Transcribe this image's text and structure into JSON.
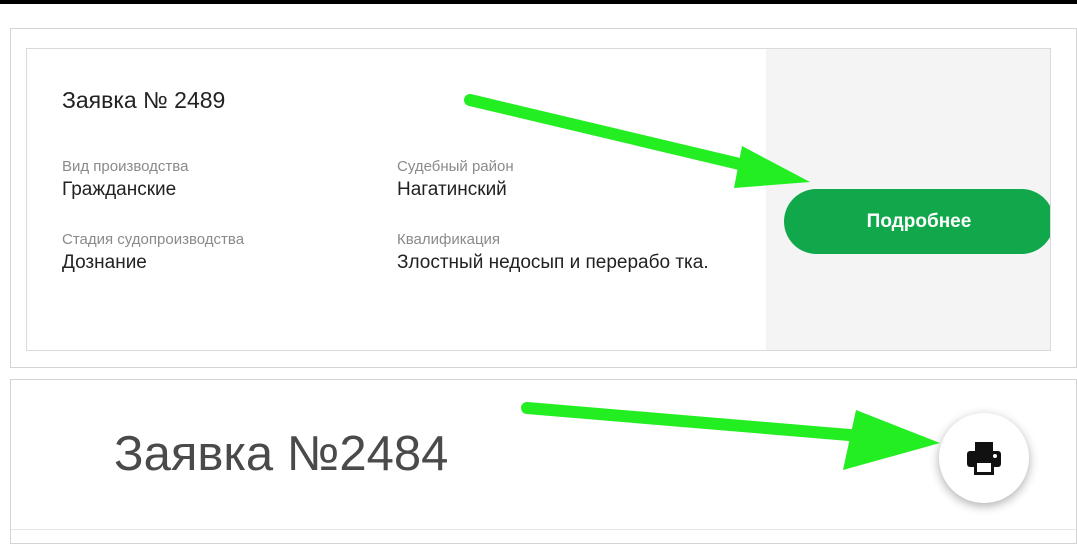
{
  "card_2489": {
    "title": "Заявка № 2489",
    "fields": {
      "vid": {
        "label": "Вид производства",
        "value": "Гражданские"
      },
      "stage": {
        "label": "Стадия судопроизводства",
        "value": "Дознание"
      },
      "court": {
        "label": "Судебный район",
        "value": "Нагатинский"
      },
      "qualification": {
        "label": "Квалификация",
        "value": "Злостный недосып и перерабо тка."
      }
    },
    "details_button": "Подробнее"
  },
  "card_2484": {
    "title": "Заявка №2484",
    "print_icon": "printer-icon"
  },
  "colors": {
    "accent_green": "#11a84c",
    "annotation_arrow": "#22ee22",
    "side_panel": "#f4f4f4"
  }
}
